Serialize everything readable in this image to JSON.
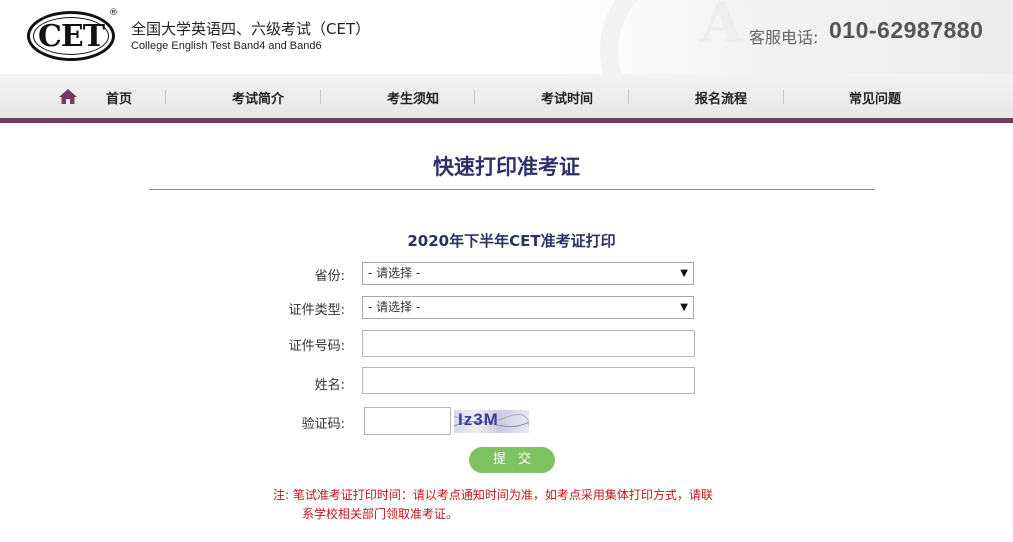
{
  "header": {
    "logo_text": "CET",
    "logo_reg": "®",
    "site_title": "全国大学英语四、六级考试（CET）",
    "site_subtitle": "College English Test Band4 and Band6",
    "hotline_label": "客服电话:",
    "hotline_number": "010-62987880"
  },
  "nav": {
    "items": [
      {
        "label": "首页"
      },
      {
        "label": "考试简介"
      },
      {
        "label": "考生须知"
      },
      {
        "label": "考试时间"
      },
      {
        "label": "报名流程"
      },
      {
        "label": "常见问题"
      }
    ]
  },
  "main": {
    "page_title": "快速打印准考证",
    "form_title": "2020年下半年CET准考证打印",
    "fields": {
      "province": {
        "label": "省份:",
        "value": "- 请选择 -"
      },
      "id_type": {
        "label": "证件类型:",
        "value": "- 请选择 -"
      },
      "id_number": {
        "label": "证件号码:",
        "value": ""
      },
      "name": {
        "label": "姓名:",
        "value": ""
      },
      "captcha": {
        "label": "验证码:",
        "value": "",
        "image_text": "Iz3M"
      }
    },
    "submit_label": "提交",
    "note_line1": "注:  笔试准考证打印时间：请以考点通知时间为准，如考点采用集体打印方式，请联",
    "note_line2": "系学校相关部门领取准考证。"
  },
  "colors": {
    "accent_purple": "#7a3762",
    "title_navy": "#2c3168",
    "submit_green": "#7dc35f",
    "note_red": "#c0161a"
  }
}
